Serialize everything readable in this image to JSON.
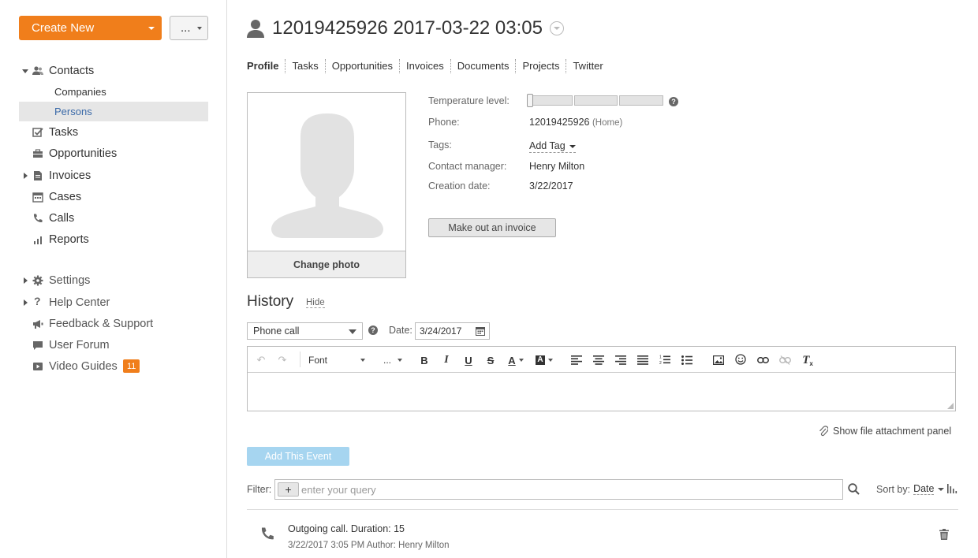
{
  "sidebar": {
    "create_label": "Create New",
    "more_label": "...",
    "items": [
      {
        "label": "Contacts"
      },
      {
        "label": "Companies"
      },
      {
        "label": "Persons"
      },
      {
        "label": "Tasks"
      },
      {
        "label": "Opportunities"
      },
      {
        "label": "Invoices"
      },
      {
        "label": "Cases"
      },
      {
        "label": "Calls"
      },
      {
        "label": "Reports"
      },
      {
        "label": "Settings"
      },
      {
        "label": "Help Center"
      },
      {
        "label": "Feedback & Support"
      },
      {
        "label": "User Forum"
      },
      {
        "label": "Video Guides",
        "badge": "11"
      }
    ]
  },
  "header": {
    "title": "12019425926 2017-03-22 03:05"
  },
  "tabs": [
    "Profile",
    "Tasks",
    "Opportunities",
    "Invoices",
    "Documents",
    "Projects",
    "Twitter"
  ],
  "profile": {
    "change_photo": "Change photo",
    "temperature_label": "Temperature level:",
    "temperature_level": 0,
    "phone_label": "Phone:",
    "phone_value": "12019425926",
    "phone_type": "(Home)",
    "tags_label": "Tags:",
    "add_tag": "Add Tag",
    "manager_label": "Contact manager:",
    "manager_value": "Henry Milton",
    "creation_label": "Creation date:",
    "creation_value": "3/22/2017",
    "invoice_button": "Make out an invoice"
  },
  "history": {
    "title": "History",
    "hide": "Hide",
    "event_type": "Phone call",
    "date_label": "Date:",
    "date_value": "3/24/2017",
    "toolbar": {
      "font": "Font",
      "size": "..."
    },
    "attach": "Show file attachment panel",
    "add_event": "Add This Event",
    "filter_label": "Filter:",
    "filter_placeholder": "enter your query",
    "sort_label": "Sort by:",
    "sort_value": "Date",
    "events": [
      {
        "title": "Outgoing call. Duration: 15",
        "meta": "3/22/2017 3:05 PM Author: Henry Milton"
      }
    ]
  },
  "colors": {
    "accent": "#f07e1b",
    "link_active": "#3b6aa8",
    "add_event_bg": "#a6d5f0"
  }
}
